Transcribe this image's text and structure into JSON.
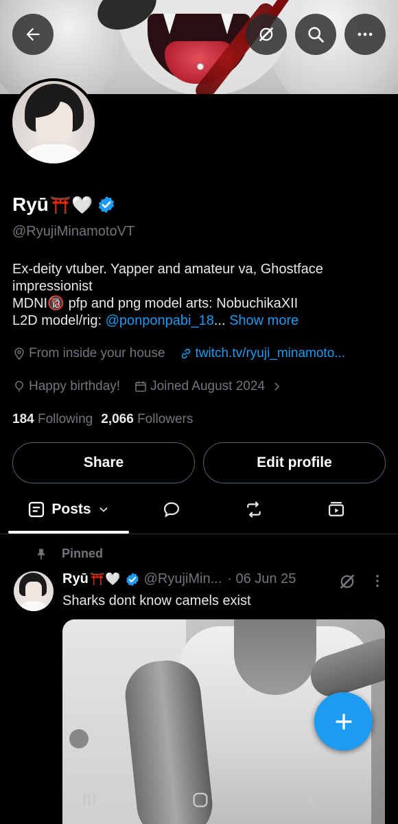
{
  "profile": {
    "name": "Ryū",
    "name_emojis": "⛩️🤍",
    "handle": "@RyujiMinamotoVT",
    "bio_line1": "Ex-deity vtuber. Yapper and amateur va,  Ghostface impressionist",
    "bio_line2_a": "MDNI",
    "bio_line2_emoji": "🔞",
    "bio_line2_b": " pfp and png model arts: NobuchikaXII",
    "bio_line3_a": "L2D model/rig: ",
    "bio_line3_link": "@ponponpabi_18",
    "bio_line3_ellipsis": "...",
    "bio_show_more": "Show more",
    "location": "From inside your house",
    "website": "twitch.tv/ryuji_minamoto...",
    "birthday": "Happy birthday!",
    "joined": "Joined August 2024",
    "following_count": "184",
    "following_label": "Following",
    "followers_count": "2,066",
    "followers_label": "Followers"
  },
  "buttons": {
    "share": "Share",
    "edit_profile": "Edit profile"
  },
  "tabs": {
    "posts": "Posts"
  },
  "post": {
    "pinned_label": "Pinned",
    "name": "Ryū",
    "name_emojis": "⛩️🤍",
    "handle": "@RyujiMin...",
    "date": "· 06 Jun 25",
    "text": "Sharks dont know camels exist"
  },
  "colors": {
    "accent": "#1d9bf0",
    "background": "#000000",
    "secondary_text": "#71767b",
    "border": "#536471"
  },
  "icons": {
    "back": "arrow-left-icon",
    "grok": "grok-icon",
    "search": "search-icon",
    "more": "more-horizontal-icon",
    "verified": "verified-badge-icon",
    "location": "location-pin-icon",
    "link": "link-icon",
    "birthday": "balloon-icon",
    "calendar": "calendar-icon",
    "chevron": "chevron-right-icon",
    "posts_tab": "posts-tab-icon",
    "replies_tab": "reply-bubble-icon",
    "reposts_tab": "repost-icon",
    "media_tab": "media-icon",
    "pin": "pin-icon",
    "compose": "plus-icon",
    "nav_recents": "recents-icon",
    "nav_home": "home-icon",
    "nav_back": "nav-back-icon"
  }
}
